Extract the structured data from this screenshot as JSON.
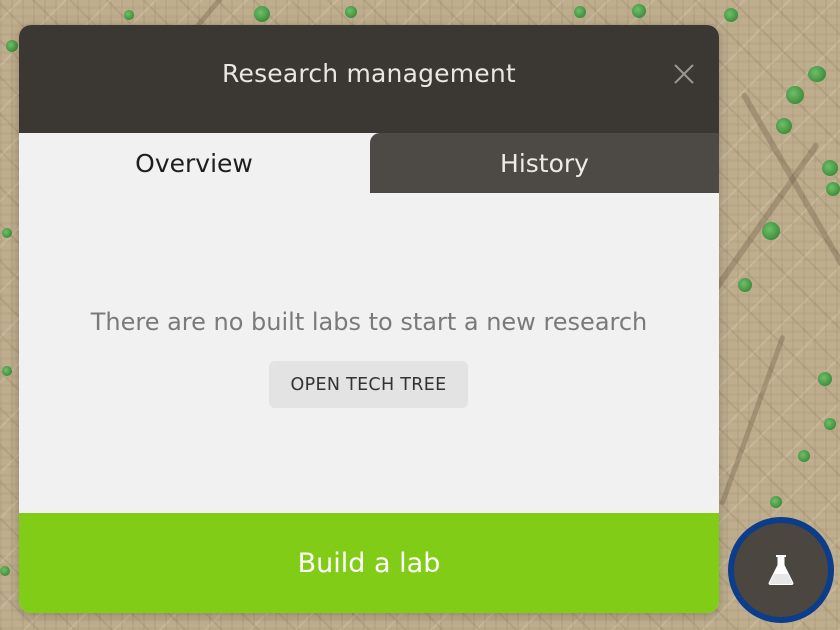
{
  "dialog": {
    "title": "Research management",
    "tabs": [
      {
        "label": "Overview",
        "active": true
      },
      {
        "label": "History",
        "active": false
      }
    ],
    "empty_message": "There are no built labs to start a new research",
    "tech_tree_button": "OPEN TECH TREE",
    "build_button": "Build a lab"
  },
  "hud": {
    "research_button_icon": "flask-icon"
  },
  "colors": {
    "header": "#3b3732",
    "active_tab": "#f1f1f1",
    "inactive_tab": "#4d4944",
    "build_button": "#80cc17",
    "fab_ring": "#0c3d8a"
  }
}
